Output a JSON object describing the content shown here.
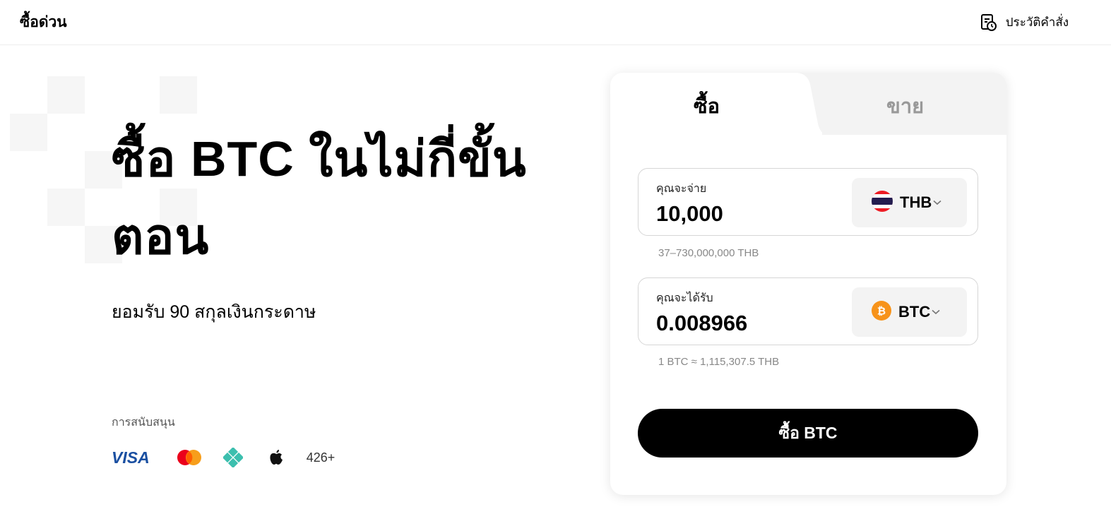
{
  "header": {
    "brand": "ซื้อด่วน",
    "history_label": "ประวัติคำสั่ง"
  },
  "hero": {
    "title_line1": "ซื้อ BTC ในไม่กี่ขั้น",
    "title_line2": "ตอน",
    "subtitle": "ยอมรับ 90 สกุลเงินกระดาษ"
  },
  "support": {
    "label": "การสนับสนุน",
    "methods": [
      "VISA",
      "mastercard-icon",
      "diamond-pay-icon",
      "apple-pay-icon"
    ],
    "visa_text": "VISA",
    "more": "426+"
  },
  "trade": {
    "tabs": {
      "buy": "ซื้อ",
      "sell": "ขาย",
      "active": "buy"
    },
    "pay": {
      "label": "คุณจะจ่าย",
      "value": "10,000",
      "currency": "THB",
      "range_hint": "37–730,000,000 THB"
    },
    "receive": {
      "label": "คุณจะได้รับ",
      "value": "0.008966",
      "currency": "BTC",
      "rate_hint": "1 BTC ≈ 1,115,307.5 THB"
    },
    "submit_label": "ซื้อ BTC"
  },
  "colors": {
    "accent": "#000000",
    "btc_orange": "#F7931A",
    "visa_blue": "#1A4FA1",
    "muted_tab": "#F3F3F3"
  }
}
